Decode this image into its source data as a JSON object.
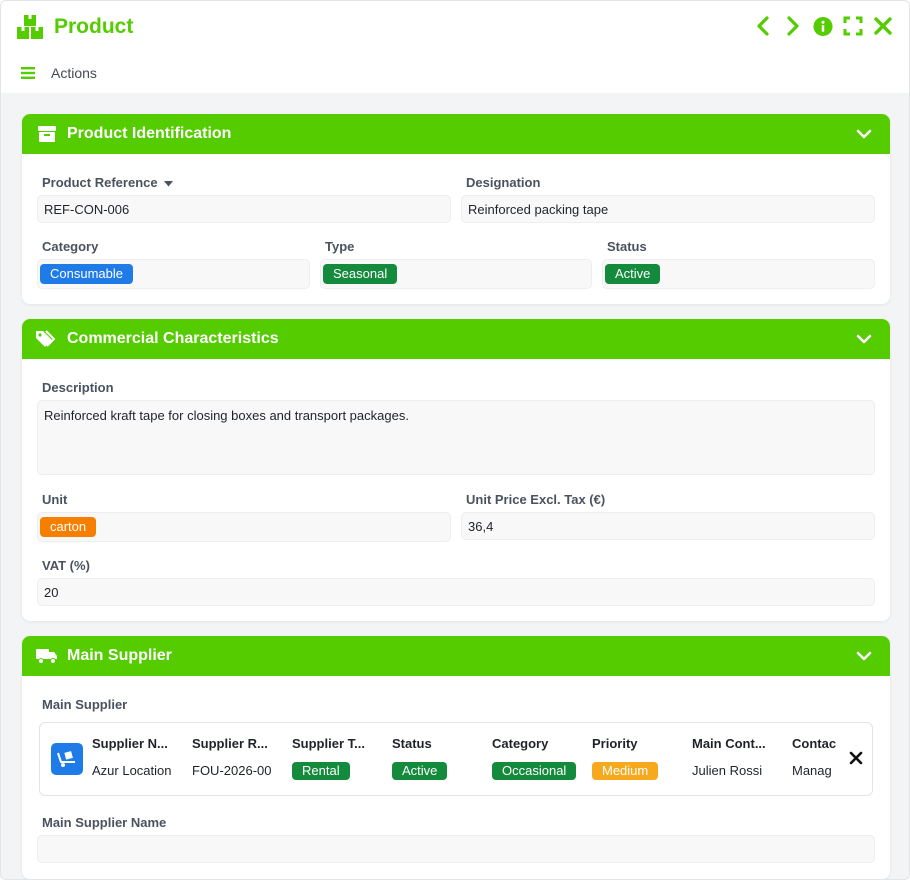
{
  "window": {
    "title": "Product",
    "actions_label": "Actions"
  },
  "colors": {
    "brand": "#55cc00",
    "blue_tag": "#1f7be8",
    "green_tag": "#148a3c",
    "orange_tag": "#f77f00",
    "yellow_tag": "#f6a91d"
  },
  "icons": {
    "logo": "boxes-icon",
    "prev": "chevron-left-icon",
    "next": "chevron-right-icon",
    "info": "info-circle-icon",
    "expand": "expand-icon",
    "close": "close-icon",
    "menu": "hamburger-icon"
  },
  "identification": {
    "title": "Product Identification",
    "reference_label": "Product Reference",
    "reference_value": "REF-CON-006",
    "designation_label": "Designation",
    "designation_value": "Reinforced packing tape",
    "category_label": "Category",
    "category_value": "Consumable",
    "type_label": "Type",
    "type_value": "Seasonal",
    "status_label": "Status",
    "status_value": "Active"
  },
  "commercial": {
    "title": "Commercial Characteristics",
    "description_label": "Description",
    "description_value": "Reinforced kraft tape for closing boxes and transport packages.",
    "unit_label": "Unit",
    "unit_value": "carton",
    "price_label": "Unit Price Excl. Tax (€)",
    "price_value": "36,4",
    "vat_label": "VAT (%)",
    "vat_value": "20"
  },
  "supplier": {
    "title": "Main Supplier",
    "field_label": "Main Supplier",
    "columns": [
      {
        "head": "Supplier N...",
        "value": "Azur Location"
      },
      {
        "head": "Supplier R...",
        "value": "FOU-2026-00"
      },
      {
        "head": "Supplier T...",
        "value": "Rental"
      },
      {
        "head": "Status",
        "value": "Active"
      },
      {
        "head": "Category",
        "value": "Occasional"
      },
      {
        "head": "Priority",
        "value": "Medium"
      },
      {
        "head": "Main Cont...",
        "value": "Julien Rossi"
      },
      {
        "head": "Contac",
        "value": "Manag"
      }
    ],
    "name_label": "Main Supplier Name",
    "name_value": ""
  }
}
